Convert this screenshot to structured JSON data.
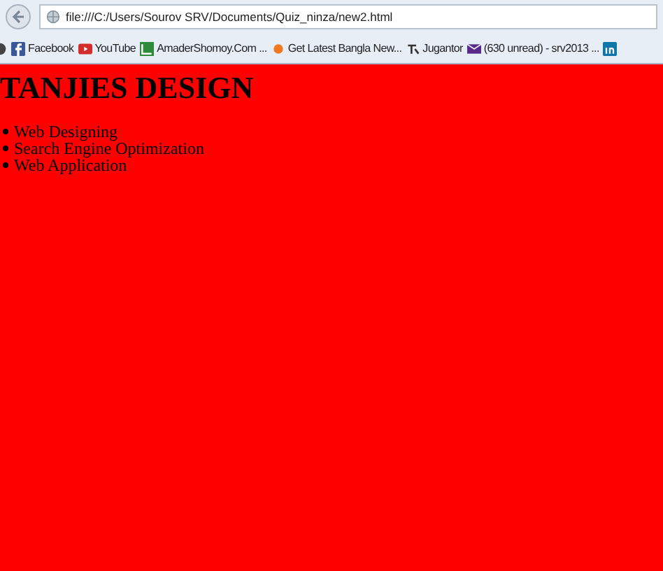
{
  "address_bar": {
    "url": "file:///C:/Users/Sourov SRV/Documents/Quiz_ninza/new2.html"
  },
  "bookmarks": [
    {
      "label": "Facebook",
      "kind": "facebook"
    },
    {
      "label": "YouTube",
      "kind": "youtube"
    },
    {
      "label": "AmaderShomoy.Com ...",
      "kind": "green"
    },
    {
      "label": "Get Latest Bangla New...",
      "kind": "dot"
    },
    {
      "label": "Jugantor",
      "kind": "glyph"
    },
    {
      "label": "(630 unread) - srv2013 ...",
      "kind": "mail"
    },
    {
      "kind": "linkedin"
    }
  ],
  "page": {
    "heading": "TANJIES DESIGN",
    "items": [
      "Web Designing",
      "Search Engine Optimization",
      "Web Application"
    ]
  }
}
